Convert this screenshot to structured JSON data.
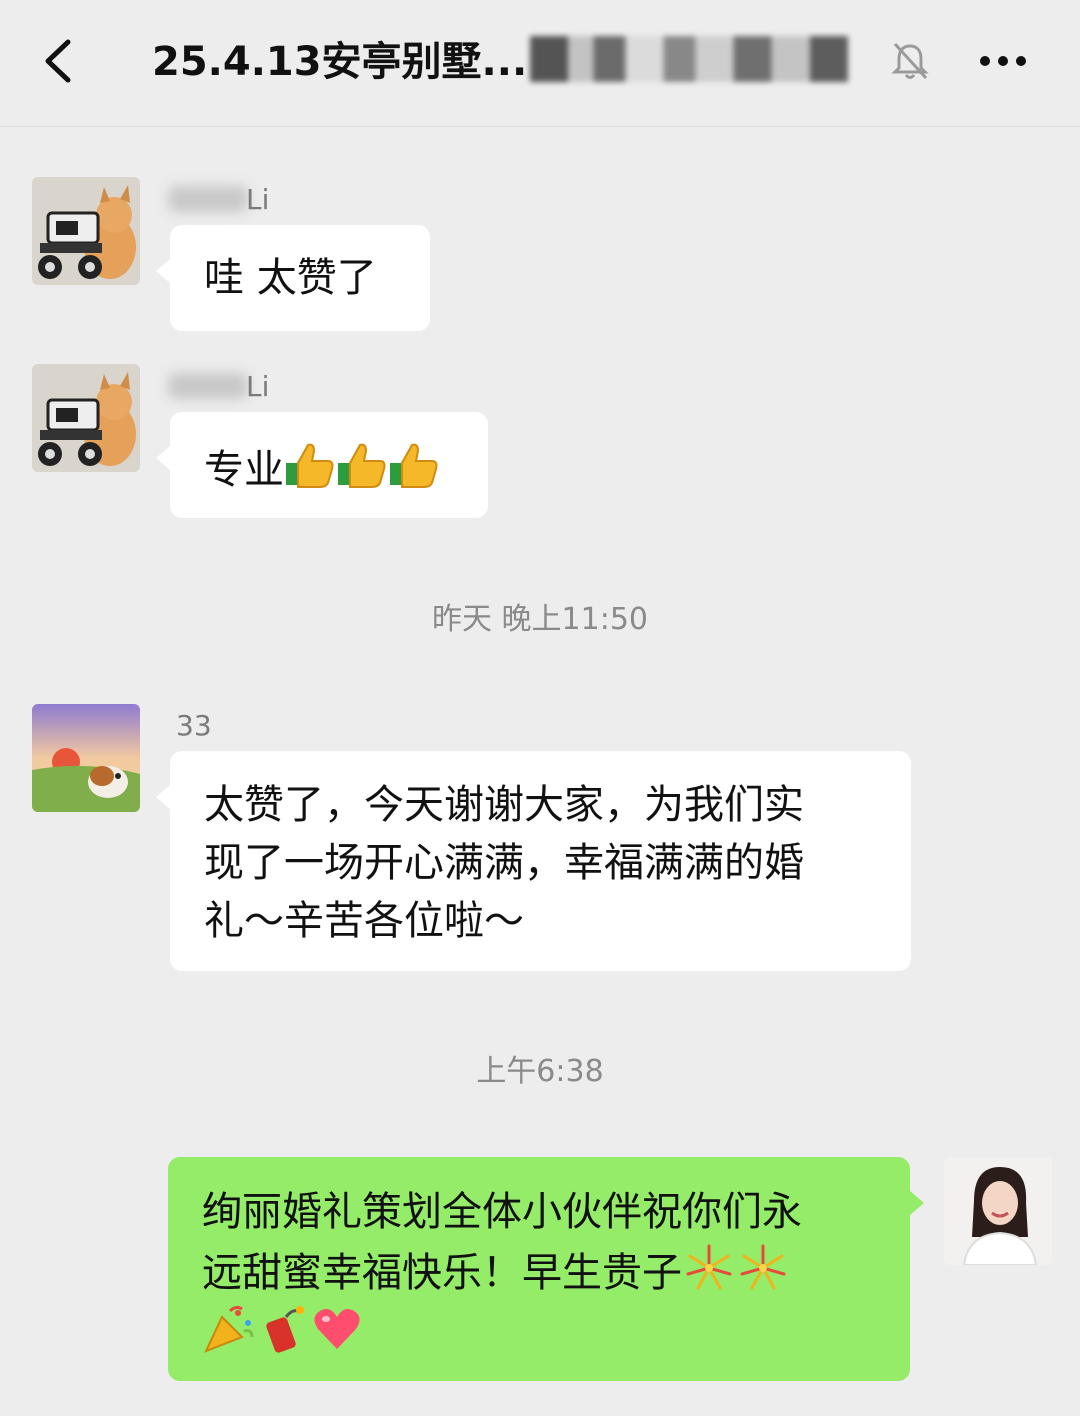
{
  "header": {
    "title": "25.4.13安亭别墅..."
  },
  "messages": [
    {
      "sender": "Li",
      "text": "哇 太赞了"
    },
    {
      "sender": "Li",
      "text": "专业"
    },
    {
      "sender": "33",
      "lines": [
        "太赞了，今天谢谢大家，为我们实",
        "现了一场开心满满，幸福满满的婚",
        "礼～辛苦各位啦～"
      ]
    },
    {
      "lines": [
        "绚丽婚礼策划全体小伙伴祝你们永",
        "远甜蜜幸福快乐！早生贵子"
      ]
    }
  ],
  "timestamps": {
    "first": "昨天 晚上11:50",
    "second": "上午6:38"
  },
  "icons": [
    "back-icon",
    "mute-bell-icon",
    "more-icon",
    "thumbs-up-icon",
    "fireworks-icon",
    "party-popper-icon",
    "firecracker-icon",
    "heart-icon"
  ],
  "colors": {
    "background": "#ededed",
    "bubble_in": "#ffffff",
    "bubble_out": "#95ec69"
  }
}
